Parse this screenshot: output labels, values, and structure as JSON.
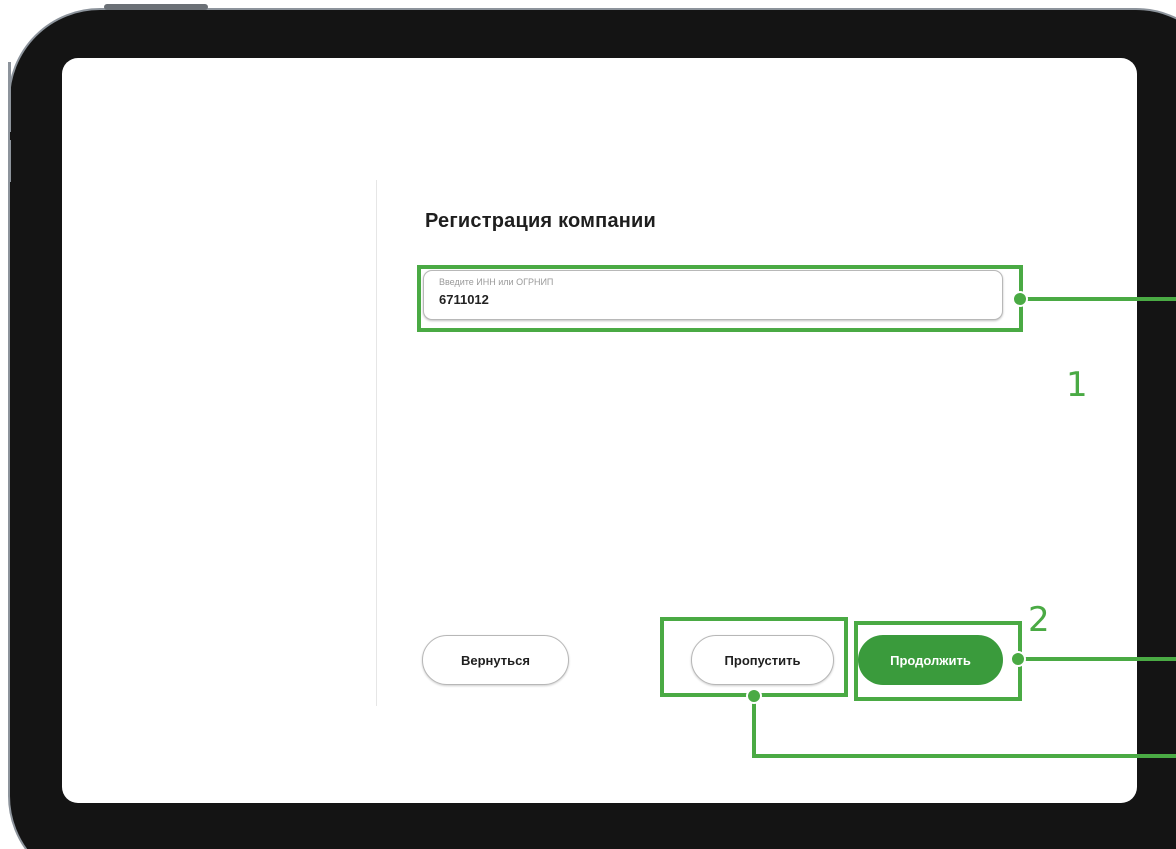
{
  "page": {
    "title": "Регистрация компании"
  },
  "company_field": {
    "label": "Введите ИНН или ОГРНИП",
    "value": "6711012"
  },
  "buttons": {
    "back": "Вернуться",
    "skip": "Пропустить",
    "continue": "Продолжить"
  },
  "callouts": {
    "first": "1",
    "second": "2"
  },
  "colors": {
    "accent": "#4aaa44",
    "primary_button": "#3a9b3c",
    "device_frame": "#141414"
  }
}
